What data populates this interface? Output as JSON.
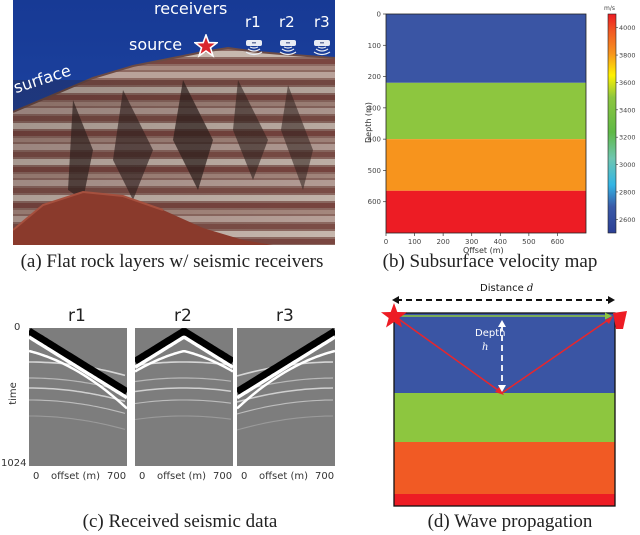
{
  "panel_a": {
    "caption": "(a) Flat rock layers w/ seismic receivers",
    "labels": {
      "receivers": "receivers",
      "source": "source",
      "surface": "surface",
      "r1": "r1",
      "r2": "r2",
      "r3": "r3"
    },
    "icons": [
      "star-icon",
      "receiver-icon"
    ],
    "colors": {
      "sky": "#1d3f99",
      "source_star": "#d9262e"
    }
  },
  "panel_b": {
    "caption": "(b) Subsurface velocity map",
    "chart_data": {
      "type": "heatmap",
      "title": "",
      "xlabel": "Offset (m)",
      "ylabel": "Depth (m)",
      "x_ticks": [
        "0",
        "100",
        "200",
        "300",
        "400",
        "500",
        "600"
      ],
      "y_ticks": [
        "0",
        "100",
        "200",
        "300",
        "400",
        "500",
        "600"
      ],
      "xlim": [
        0,
        700
      ],
      "ylim": [
        0,
        700
      ],
      "colorbar": {
        "unit": "m/s",
        "ticks": [
          "4000",
          "3800",
          "3600",
          "3400",
          "3200",
          "3000",
          "2800",
          "2600"
        ],
        "range": [
          2500,
          4100
        ]
      },
      "layers": [
        {
          "depth_top": 0,
          "depth_bottom": 220,
          "velocity": 2600,
          "color": "#3a55a4"
        },
        {
          "depth_top": 220,
          "depth_bottom": 400,
          "velocity": 3300,
          "color": "#8dc63f"
        },
        {
          "depth_top": 400,
          "depth_bottom": 565,
          "velocity": 3850,
          "color": "#f7941d"
        },
        {
          "depth_top": 565,
          "depth_bottom": 700,
          "velocity": 4050,
          "color": "#ed1c24"
        }
      ]
    }
  },
  "panel_c": {
    "caption": "(c) Received seismic data",
    "y_label": "time",
    "y_ticks": {
      "top": "0",
      "bottom": "1024"
    },
    "gathers": [
      {
        "title": "r1",
        "x_start": "0",
        "x_label": "offset (m)",
        "x_end": "700",
        "source_position": "left"
      },
      {
        "title": "r2",
        "x_start": "0",
        "x_label": "offset (m)",
        "x_end": "700",
        "source_position": "center"
      },
      {
        "title": "r3",
        "x_start": "0",
        "x_label": "offset (m)",
        "x_end": "700",
        "source_position": "right"
      }
    ]
  },
  "panel_d": {
    "caption": "(d) Wave propagation",
    "distance_label": "Distance",
    "distance_symbol": "d",
    "depth_label": "Depth",
    "depth_symbol": "h",
    "layer_colors": [
      "#3a55a4",
      "#8dc63f",
      "#f15a24",
      "#ed1c24"
    ],
    "ray_color": "#e8262c"
  }
}
